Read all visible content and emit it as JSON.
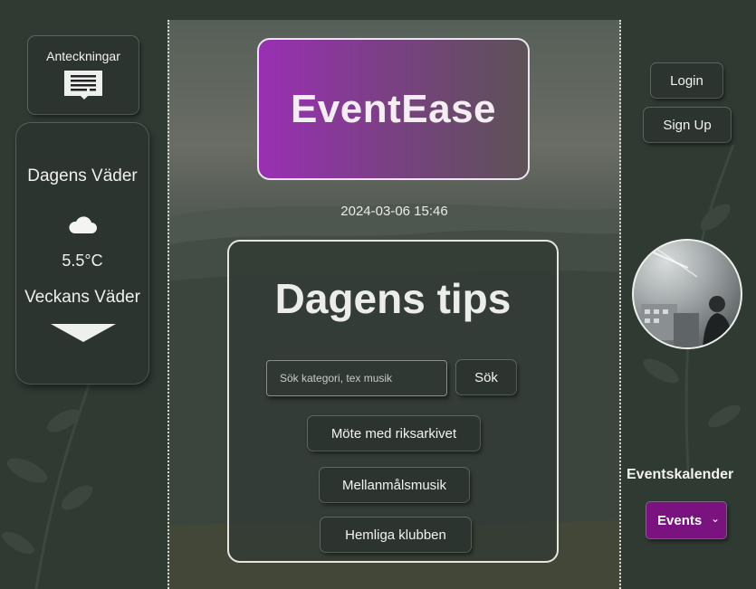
{
  "notes": {
    "label": "Anteckningar",
    "icon": "document-icon"
  },
  "weather": {
    "today_label": "Dagens Väder",
    "icon": "cloud-icon",
    "temperature": "5.5°C",
    "week_label": "Veckans Väder",
    "expand_icon": "triangle-down-icon"
  },
  "header": {
    "brand": "EventEase",
    "datetime": "2024-03-06 15:46"
  },
  "tips": {
    "title": "Dagens tips",
    "search_placeholder": "Sök kategori, tex musik",
    "search_value": "",
    "search_button": "Sök",
    "items": [
      {
        "label": "Möte med riksarkivet"
      },
      {
        "label": "Mellanmålsmusik"
      },
      {
        "label": "Hemliga klubben"
      }
    ]
  },
  "auth": {
    "login": "Login",
    "signup": "Sign Up"
  },
  "profile": {
    "avatar": "profile-photo"
  },
  "calendar": {
    "title": "Eventskalender",
    "selected": "Events"
  },
  "colors": {
    "background": "#2f3a33",
    "panel": "#2b342e",
    "brand_gradient_start": "#9a2fb4",
    "brand_gradient_end": "#5c5256",
    "select_bg": "#7a1380"
  }
}
